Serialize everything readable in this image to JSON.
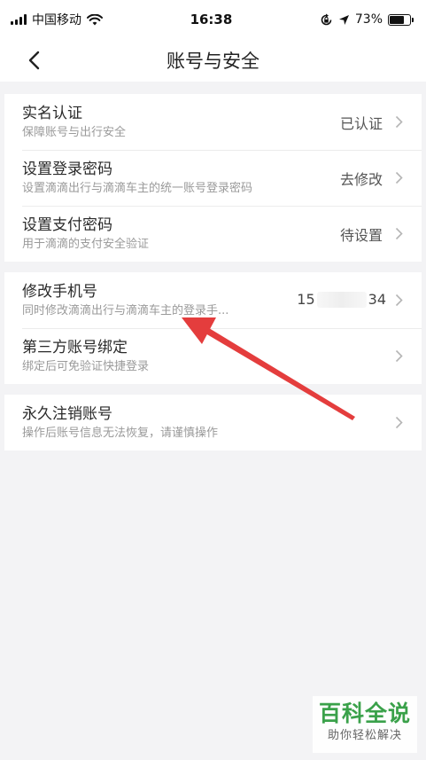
{
  "status_bar": {
    "carrier": "中国移动",
    "time": "16:38",
    "battery": "73%",
    "battery_level": 0.73
  },
  "nav": {
    "title": "账号与安全"
  },
  "groups": [
    {
      "items": [
        {
          "title": "实名认证",
          "subtitle": "保障账号与出行安全",
          "value": "已认证"
        },
        {
          "title": "设置登录密码",
          "subtitle": "设置滴滴出行与滴滴车主的统一账号登录密码",
          "value": "去修改"
        },
        {
          "title": "设置支付密码",
          "subtitle": "用于滴滴的支付安全验证",
          "value": "待设置"
        }
      ]
    },
    {
      "items": [
        {
          "title": "修改手机号",
          "subtitle": "同时修改滴滴出行与滴滴车主的登录手...",
          "value_prefix": "15",
          "value_suffix": "34"
        },
        {
          "title": "第三方账号绑定",
          "subtitle": "绑定后可免验证快捷登录"
        }
      ]
    },
    {
      "items": [
        {
          "title": "永久注销账号",
          "subtitle": "操作后账号信息无法恢复，请谨慎操作"
        }
      ]
    }
  ],
  "watermark": {
    "title": "百科全说",
    "subtitle": "助你轻松解决"
  },
  "colors": {
    "background": "#f3f3f5",
    "arrow": "#e43d3d",
    "watermark_green": "#3aa14a"
  }
}
